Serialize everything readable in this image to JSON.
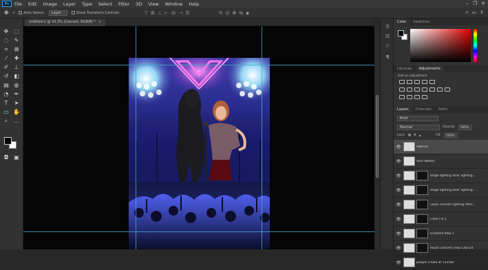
{
  "menubar": {
    "logo": "Ps",
    "items": [
      "File",
      "Edit",
      "Image",
      "Layer",
      "Type",
      "Select",
      "Filter",
      "3D",
      "View",
      "Window",
      "Help"
    ]
  },
  "options_bar": {
    "auto_select_label": "Auto-Select:",
    "auto_select_value": "Layer",
    "show_transform_label": "Show Transform Controls"
  },
  "document_tab": {
    "title": "Untitled-1 @ 33.3% (Concert, RGB/8) *",
    "close": "×"
  },
  "panels": {
    "color_tabs": [
      "Color",
      "Swatches"
    ],
    "adjustment_tabs": [
      "Libraries",
      "Adjustments"
    ],
    "adjustment_label": "Add an adjustment",
    "layer_tabs": [
      "Layers",
      "Channels",
      "Paths"
    ],
    "layer_filter": "Kind",
    "blend_mode": "Normal",
    "opacity_label": "Opacity:",
    "opacity_value": "100%",
    "lock_label": "Lock:",
    "fill_label": "Fill:",
    "fill_value": "100%"
  },
  "layers": [
    {
      "name": "Sabrina",
      "selected": true,
      "mask": false
    },
    {
      "name": "Alan Walker",
      "selected": false,
      "mask": false
    },
    {
      "name": "stage lighting laser lighting...",
      "selected": false,
      "mask": true
    },
    {
      "name": "stage lighting laser lighting...",
      "selected": false,
      "mask": true
    },
    {
      "name": "Layer concert lighting effec...",
      "selected": false,
      "mask": true
    },
    {
      "name": "Color Fill 1",
      "selected": false,
      "mask": true
    },
    {
      "name": "Gradient Map 1",
      "selected": false,
      "mask": true
    },
    {
      "name": "music concert crow 138724",
      "selected": false,
      "mask": true
    },
    {
      "name": "people crowd at 133582",
      "selected": false,
      "mask": false
    }
  ],
  "colors": {
    "accent": "#31a8ff",
    "guide": "#3fa6c9",
    "canvas_bg": "#050505",
    "panel_bg": "#323232"
  }
}
